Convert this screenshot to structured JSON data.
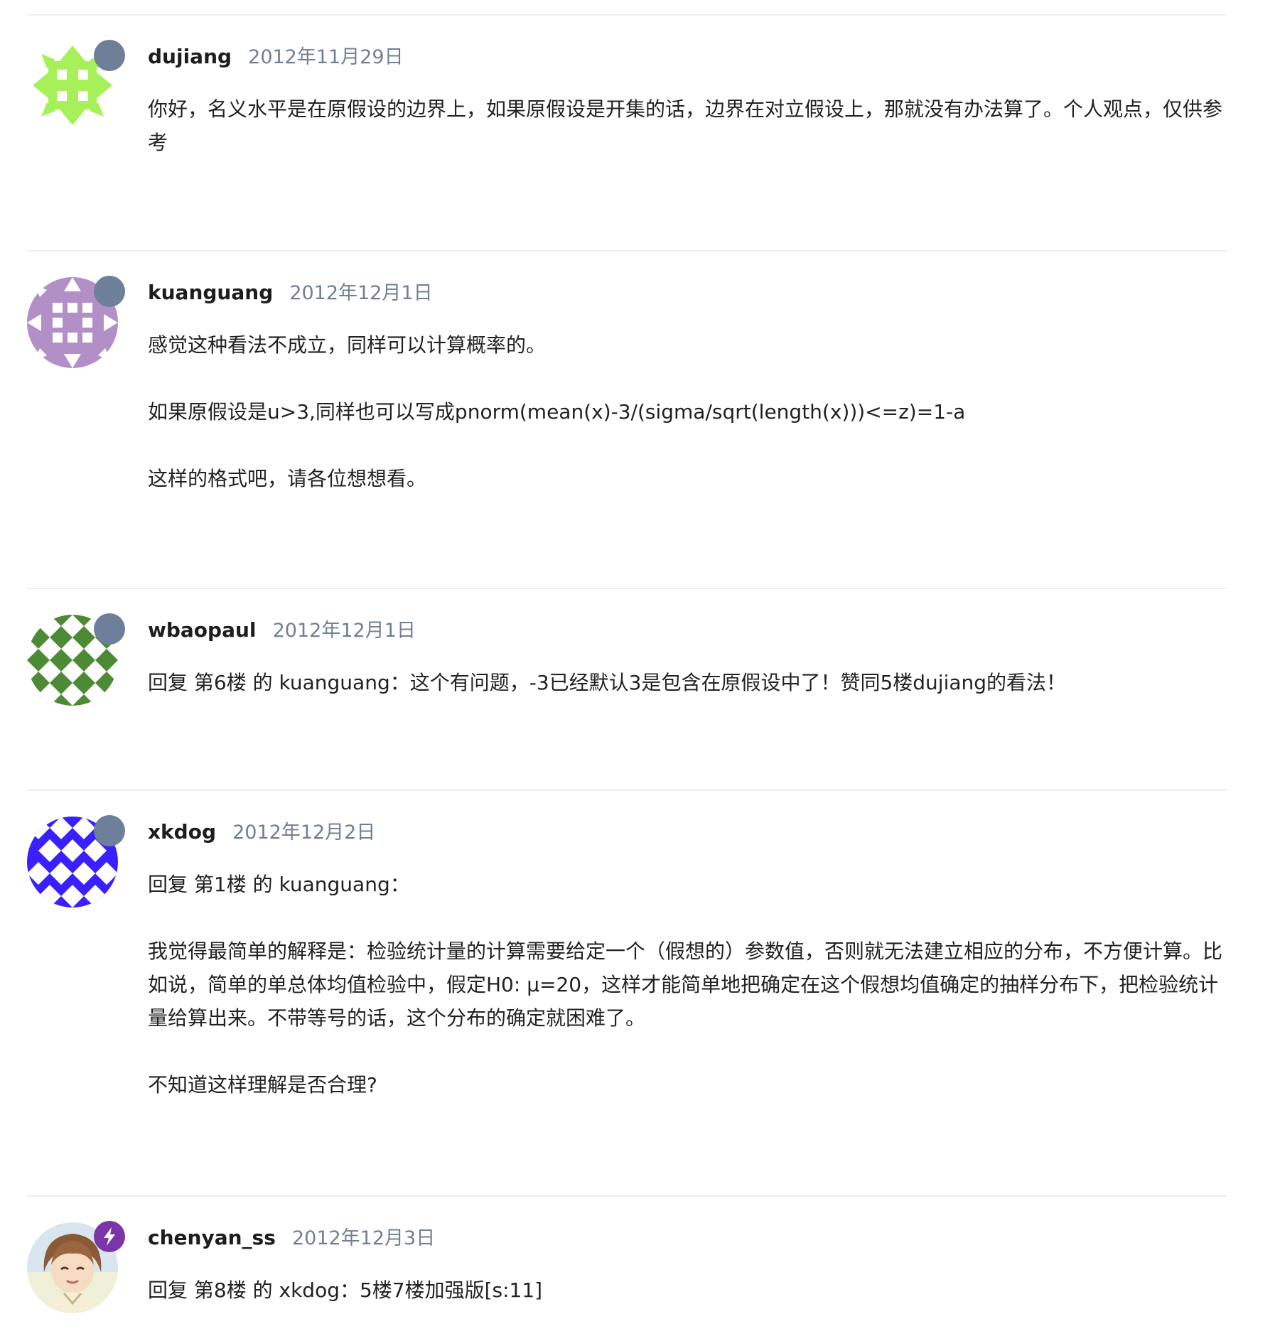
{
  "comments": [
    {
      "author": "dujiang",
      "date": "2012年11月29日",
      "avatar": "identicon-green-avatar",
      "badge": "default-dot",
      "paragraphs": [
        "你好，名义水平是在原假设的边界上，如果原假设是开集的话，边界在对立假设上，那就没有办法算了。个人观点，仅供参考"
      ]
    },
    {
      "author": "kuanguang",
      "date": "2012年12月1日",
      "avatar": "identicon-purple-avatar",
      "badge": "default-dot",
      "paragraphs": [
        "感觉这种看法不成立，同样可以计算概率的。",
        "如果原假设是u>3,同样也可以写成pnorm(mean(x)-3/(sigma/sqrt(length(x)))<=z)=1-a",
        "这样的格式吧，请各位想想看。"
      ]
    },
    {
      "author": "wbaopaul",
      "date": "2012年12月1日",
      "avatar": "identicon-dark-green-avatar",
      "badge": "default-dot",
      "paragraphs": [
        "回复 第6楼 的 kuanguang：这个有问题，-3已经默认3是包含在原假设中了！赞同5楼dujiang的看法！"
      ]
    },
    {
      "author": "xkdog",
      "date": "2012年12月2日",
      "avatar": "identicon-blue-avatar",
      "badge": "default-dot",
      "paragraphs": [
        "回复 第1楼 的 kuanguang：",
        "我觉得最简单的解释是：检验统计量的计算需要给定一个（假想的）参数值，否则就无法建立相应的分布，不方便计算。比如说，简单的单总体均值检验中，假定H0: μ=20，这样才能简单地把确定在这个假想均值确定的抽样分布下，把检验统计量给算出来。不带等号的话，这个分布的确定就困难了。",
        "不知道这样理解是否合理?"
      ]
    },
    {
      "author": "chenyan_ss",
      "date": "2012年12月3日",
      "avatar": "photo-avatar",
      "badge": "lightning-icon",
      "paragraphs": [
        "回复 第8楼 的 xkdog：5楼7楼加强版[s:11]"
      ]
    }
  ],
  "colors": {
    "green_identicon": "#a6f059",
    "purple_identicon": "#b38fc8",
    "dark_green_identicon": "#4d8a35",
    "blue_identicon": "#3a1fff",
    "badge_default": "#6d7f99",
    "badge_lightning": "#7a36a8",
    "date_text": "#6f7f94",
    "divider": "#eceef1"
  }
}
